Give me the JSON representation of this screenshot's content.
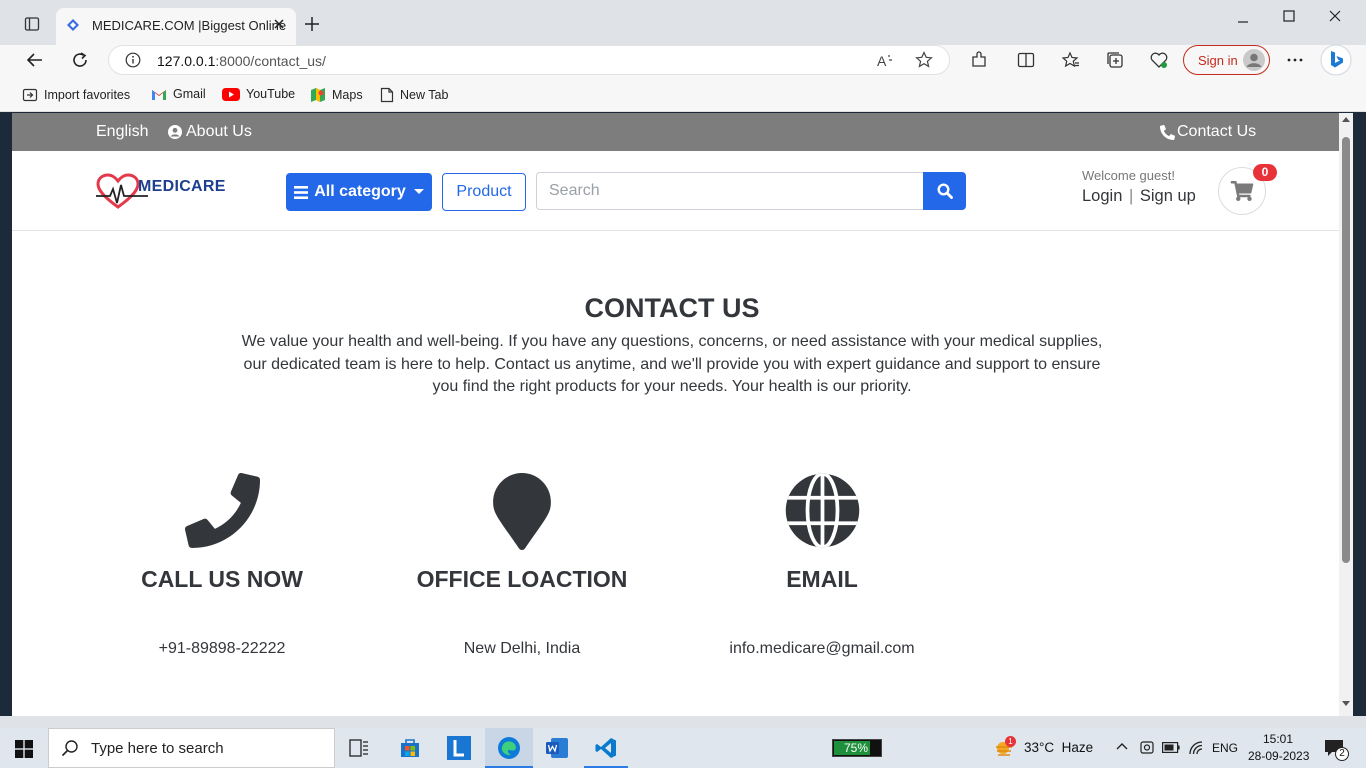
{
  "browser": {
    "tab_title": "MEDICARE.COM |Biggest Online",
    "url_host": "127.0.0.1",
    "url_rest": ":8000/contact_us/",
    "sign_in": "Sign in",
    "bookmarks": [
      "Import favorites",
      "Gmail",
      "YouTube",
      "Maps",
      "New Tab"
    ]
  },
  "topnav": {
    "language": "English",
    "about": "About Us",
    "contact": "Contact Us"
  },
  "header": {
    "logo_text": "MEDICARE",
    "category_label": "All category",
    "product_label": "Product",
    "search_placeholder": "Search",
    "welcome": "Welcome guest!",
    "login": "Login",
    "separator": "|",
    "signup": "Sign up",
    "cart_count": "0"
  },
  "contact": {
    "title": "CONTACT US",
    "description": "We value your health and well-being. If you have any questions, concerns, or need assistance with your medical supplies, our dedicated team is here to help. Contact us anytime, and we'll provide you with expert guidance and support to ensure you find the right products for your needs. Your health is our priority.",
    "columns": [
      {
        "heading": "CALL US NOW",
        "value": "+91-89898-22222",
        "icon": "phone-icon"
      },
      {
        "heading": "OFFICE LOACTION",
        "value": "New Delhi, India",
        "icon": "map-marker-icon"
      },
      {
        "heading": "EMAIL",
        "value": "info.medicare@gmail.com",
        "icon": "globe-icon"
      }
    ]
  },
  "taskbar": {
    "search_placeholder": "Type here to search",
    "battery": "75%",
    "weather": "33°C  Haze",
    "language": "ENG",
    "time": "15:01",
    "date": "28-09-2023",
    "notifications": "2",
    "weather_badge": "1"
  },
  "colors": {
    "primary": "#2268e8",
    "topnav": "#7d7d7d",
    "text": "#33363b",
    "badge": "#e8323a"
  }
}
